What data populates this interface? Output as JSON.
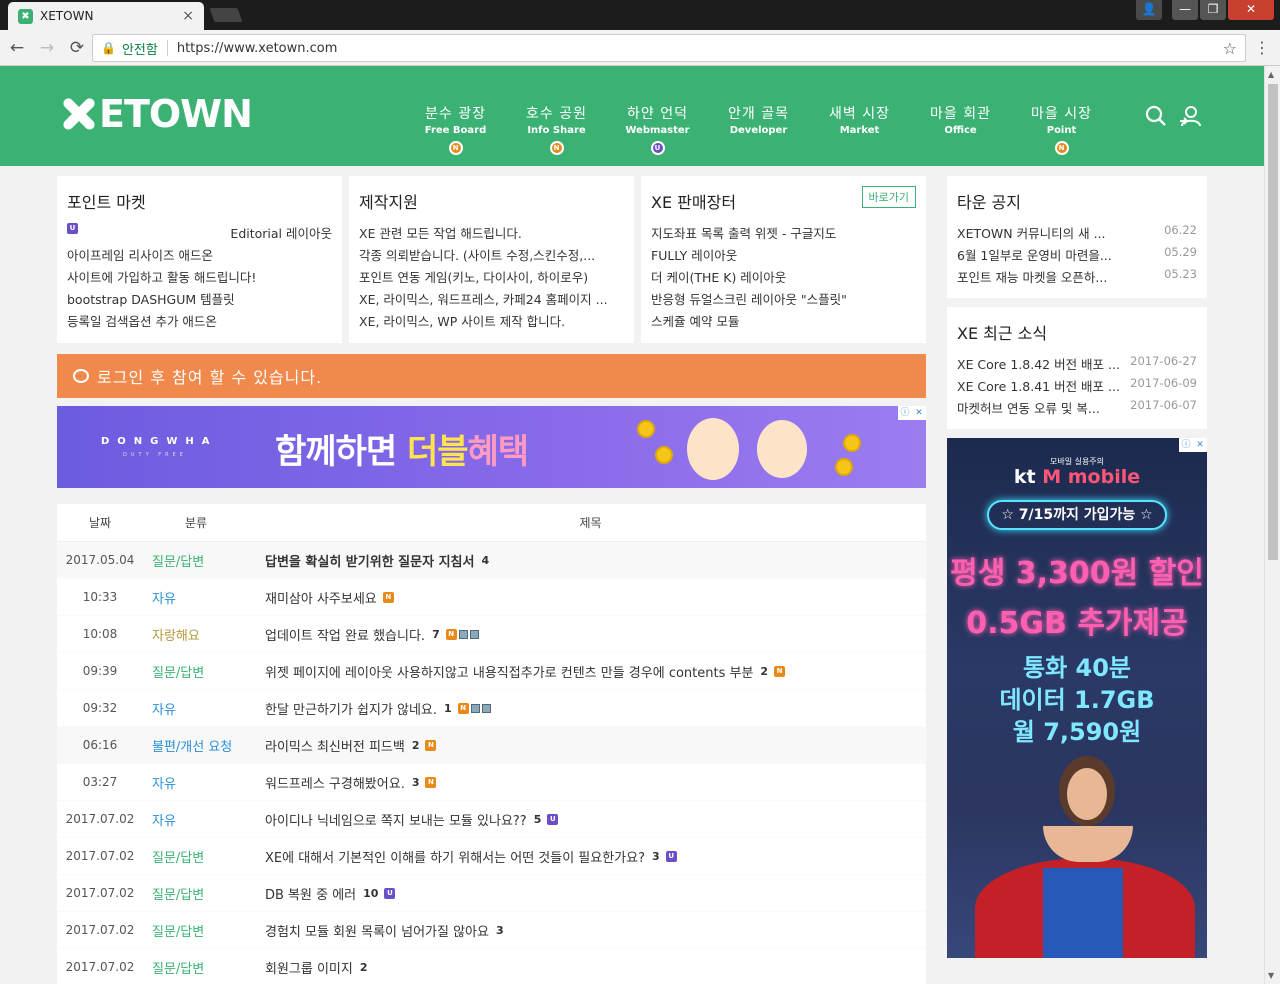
{
  "browser": {
    "tab_title": "XETOWN",
    "tab_close": "×",
    "tab_favicon": "✖",
    "secure_label": "안전함",
    "url": "https://www.xetown.com",
    "back": "←",
    "forward": "→",
    "reload": "⟳",
    "star": "☆",
    "menu": "⋮",
    "win_user": "👤",
    "win_min": "—",
    "win_max": "❐",
    "win_close": "✕"
  },
  "header": {
    "logo": "ETOWN",
    "nav": [
      {
        "ko": "분수 광장",
        "en": "Free Board",
        "badge": "N"
      },
      {
        "ko": "호수 공원",
        "en": "Info Share",
        "badge": "N"
      },
      {
        "ko": "하얀 언덕",
        "en": "Webmaster",
        "badge": "U"
      },
      {
        "ko": "안개 골목",
        "en": "Developer",
        "badge": ""
      },
      {
        "ko": "새벽 시장",
        "en": "Market",
        "badge": ""
      },
      {
        "ko": "마을 회관",
        "en": "Office",
        "badge": ""
      },
      {
        "ko": "마을 시장",
        "en": "Point",
        "badge": "N"
      }
    ],
    "search_icon": "⚲",
    "login_icon": "⚇"
  },
  "cards": {
    "point_market": {
      "title": "포인트 마켓",
      "items": [
        "Editorial 레이아웃",
        "아이프레임 리사이즈 애드온",
        "사이트에 가입하고 활동 해드립니다!",
        "bootstrap DASHGUM 템플릿",
        "등록일 검색옵션 추가 애드온"
      ]
    },
    "production": {
      "title": "제작지원",
      "items": [
        "XE 관련 모든 작업 해드립니다.",
        "각종 의뢰받습니다. (사이트 수정,스킨수정,...",
        "포인트 연동 게임(키노, 다이사이, 하이로우)",
        "XE, 라이믹스, 워드프레스, 카페24 홈페이지 ...",
        "XE, 라이믹스, WP 사이트 제작 합니다."
      ]
    },
    "xe_shop": {
      "title": "XE 판매장터",
      "more": "바로가기",
      "items": [
        "지도좌표 목록 출력 위젯 - 구글지도",
        "FULLY 레이아웃",
        "더 케이(THE K) 레이아웃",
        "반응형 듀얼스크린 레이아웃 \"스플릿\"",
        "스케쥴 예약 모듈"
      ]
    },
    "town_notice": {
      "title": "타운 공지",
      "items": [
        {
          "t": "XETOWN 커뮤니티의 새 ...",
          "d": "06.22"
        },
        {
          "t": "6월 1일부로 운영비 마련을...",
          "d": "05.29"
        },
        {
          "t": "포인트 재능 마켓을 오픈하...",
          "d": "05.23"
        }
      ]
    },
    "xe_news": {
      "title": "XE 최근 소식",
      "items": [
        {
          "t": "XE Core 1.8.42 버전 배포 ...",
          "d": "2017-06-27"
        },
        {
          "t": "XE Core 1.8.41 버전 배포 ...",
          "d": "2017-06-09"
        },
        {
          "t": "마켓허브 연동 오류 및 복...",
          "d": "2017-06-07"
        }
      ]
    }
  },
  "login_notice": "로그인 후 참여 할 수 있습니다.",
  "ad_banner": {
    "brand": "DONGWHA",
    "brand_sub": "DUTY FREE",
    "text_a": "함께하면 ",
    "text_b": "더블",
    "text_c": "혜택"
  },
  "side_ad": {
    "small": "모바일 실용주의",
    "logo_a": "kt ",
    "logo_b": "M mobile",
    "pill": "☆ 7/15까지 가입가능 ☆",
    "line1": "평생 3,300원 할인",
    "line2": "0.5GB 추가제공",
    "line3": "통화 40분",
    "line4": "데이터 1.7GB",
    "line5": "월 7,590원"
  },
  "board": {
    "headers": {
      "date": "날짜",
      "category": "분류",
      "title": "제목"
    },
    "rows": [
      {
        "date": "2017.05.04",
        "cat": "질문/답변",
        "cat_color": "#3bb273",
        "title": "답변을 확실히 받기위한 질문자 지침서",
        "cmt": "4",
        "badge": "",
        "files": false,
        "notice": true
      },
      {
        "date": "10:33",
        "cat": "자유",
        "cat_color": "#2a8fd6",
        "title": "재미삼아 사주보세요",
        "cmt": "",
        "badge": "N",
        "files": false,
        "notice": false
      },
      {
        "date": "10:08",
        "cat": "자랑해요",
        "cat_color": "#b59a3a",
        "title": "업데이트 작업 완료 했습니다.",
        "cmt": "7",
        "badge": "N",
        "files": true,
        "notice": false
      },
      {
        "date": "09:39",
        "cat": "질문/답변",
        "cat_color": "#3bb273",
        "title": "위젯 페이지에 레이아웃 사용하지않고 내용직접추가로 컨텐츠 만들 경우에 contents 부분",
        "cmt": "2",
        "badge": "N",
        "files": false,
        "notice": false
      },
      {
        "date": "09:32",
        "cat": "자유",
        "cat_color": "#2a8fd6",
        "title": "한달 만근하기가 쉽지가 않네요.",
        "cmt": "1",
        "badge": "N",
        "files": true,
        "notice": false
      },
      {
        "date": "06:16",
        "cat": "불편/개선 요청",
        "cat_color": "#2a8fd6",
        "title": "라이믹스 최신버전 피드백",
        "cmt": "2",
        "badge": "N",
        "files": false,
        "notice": true
      },
      {
        "date": "03:27",
        "cat": "자유",
        "cat_color": "#2a8fd6",
        "title": "워드프레스 구경해봤어요.",
        "cmt": "3",
        "badge": "N",
        "files": false,
        "notice": false
      },
      {
        "date": "2017.07.02",
        "cat": "자유",
        "cat_color": "#2a8fd6",
        "title": "아이디나 닉네임으로 쪽지 보내는 모듈 있나요??",
        "cmt": "5",
        "badge": "U",
        "files": false,
        "notice": false
      },
      {
        "date": "2017.07.02",
        "cat": "질문/답변",
        "cat_color": "#3bb273",
        "title": "XE에 대해서 기본적인 이해를 하기 위해서는 어떤 것들이 필요한가요?",
        "cmt": "3",
        "badge": "U",
        "files": false,
        "notice": false
      },
      {
        "date": "2017.07.02",
        "cat": "질문/답변",
        "cat_color": "#3bb273",
        "title": "DB 복원 중 에러",
        "cmt": "10",
        "badge": "U",
        "files": false,
        "notice": false
      },
      {
        "date": "2017.07.02",
        "cat": "질문/답변",
        "cat_color": "#3bb273",
        "title": "경험치 모듈 회원 목록이 넘어가질 않아요",
        "cmt": "3",
        "badge": "",
        "files": false,
        "notice": false
      },
      {
        "date": "2017.07.02",
        "cat": "질문/답변",
        "cat_color": "#3bb273",
        "title": "회원그룹 이미지",
        "cmt": "2",
        "badge": "",
        "files": false,
        "notice": false
      }
    ]
  },
  "colors": {
    "brand": "#3bb273",
    "login_bar": "#f0894b",
    "badge_new": "#e88a1a",
    "badge_update": "#6a4fc7"
  }
}
